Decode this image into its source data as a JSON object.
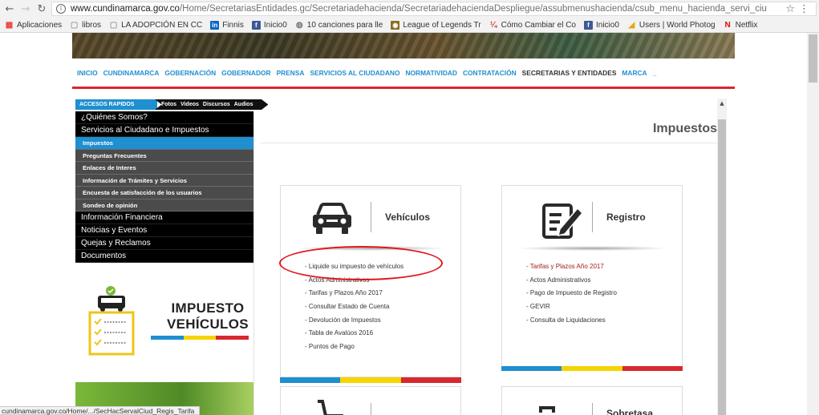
{
  "browser": {
    "url_host": "www.cundinamarca.gov.co",
    "url_path": "/Home/SecretariasEntidades.gc/Secretariadehacienda/SecretariadehaciendaDespliegue/assubmenushacienda/csub_menu_hacienda_servi_ciu",
    "status_url": "cundinamarca.gov.co/Home/.../SecHacServalCiud_Regis_Tarifa"
  },
  "bookmarks": [
    {
      "label": "Aplicaciones",
      "icon": "apps-icon",
      "color": "#e8453c"
    },
    {
      "label": "libros",
      "icon": "page-icon",
      "color": "#9e9e9e"
    },
    {
      "label": "LA ADOPCIÓN EN CC",
      "icon": "page-icon",
      "color": "#9e9e9e"
    },
    {
      "label": "Finnis",
      "icon": "linkedin-icon",
      "color": "#0a66c2"
    },
    {
      "label": "Inicio0",
      "icon": "facebook-icon",
      "color": "#3b5998"
    },
    {
      "label": "10 canciones para lle",
      "icon": "swirl-icon",
      "color": "#777777"
    },
    {
      "label": "League of Legends Tr",
      "icon": "lol-icon",
      "color": "#8a6d1f"
    },
    {
      "label": "Cómo Cambiar el Co",
      "icon": "wiki-icon",
      "color": "#d03030"
    },
    {
      "label": "Inicio0",
      "icon": "facebook-icon",
      "color": "#3b5998"
    },
    {
      "label": "Users | World Photog",
      "icon": "photo-icon",
      "color": "#e6a817"
    },
    {
      "label": "Netflix",
      "icon": "netflix-icon",
      "color": "#e50914"
    }
  ],
  "topnav": [
    "INICIO",
    "CUNDINAMARCA",
    "GOBERNACIÓN",
    "GOBERNADOR",
    "PRENSA",
    "SERVICIOS AL CIUDADANO",
    "NORMATIVIDAD",
    "CONTRATACIÓN",
    "SECRETARIAS Y ENTIDADES",
    "MARCA",
    "_"
  ],
  "quick_access": {
    "label": "ACCESOS RAPIDOS",
    "links": [
      "Fotos",
      "Videos",
      "Discursos",
      "Audios"
    ]
  },
  "sidemenu": {
    "main_items": [
      "¿Quiénes Somos?",
      "Servicios al Ciudadano e Impuestos",
      "Información Financiera",
      "Noticias y Eventos",
      "Quejas y Reclamos",
      "Documentos"
    ],
    "sub_items": [
      "Impuestos",
      "Preguntas Frecuentes",
      "Enlaces de Interes",
      "Información de Trámites y Servicios",
      "Encuesta de satisfacción de los usuarios",
      "Sondeo de opinión"
    ]
  },
  "promo": {
    "line1": "IMPUESTO",
    "line2": "VEHÍCULOS"
  },
  "page_title": "Impuestos",
  "cards": {
    "vehiculos": {
      "title": "Vehículos",
      "links": [
        "- Liquide su impuesto de vehículos",
        "- Actos Administrativos",
        "- Tarifas y Plazos Año 2017",
        "- Consultar Estado de Cuenta",
        "- Devolución de Impuestos",
        "- Tabla de Avalúos 2016",
        "- Puntos de Pago"
      ]
    },
    "registro": {
      "title": "Registro",
      "links": [
        "- Tarifas y Plazos Año 2017",
        "- Actos Administrativos",
        "- Pago de Impuesto de Registro",
        "- GEVIR",
        "- Consulta de Liquidaciones"
      ]
    },
    "sobretasa": {
      "title": "Sobretasa"
    }
  },
  "colors": {
    "accent_blue": "#1e8fd0",
    "accent_yellow": "#f5d400",
    "accent_red": "#d7282f",
    "highlight_red": "#e3161e"
  }
}
